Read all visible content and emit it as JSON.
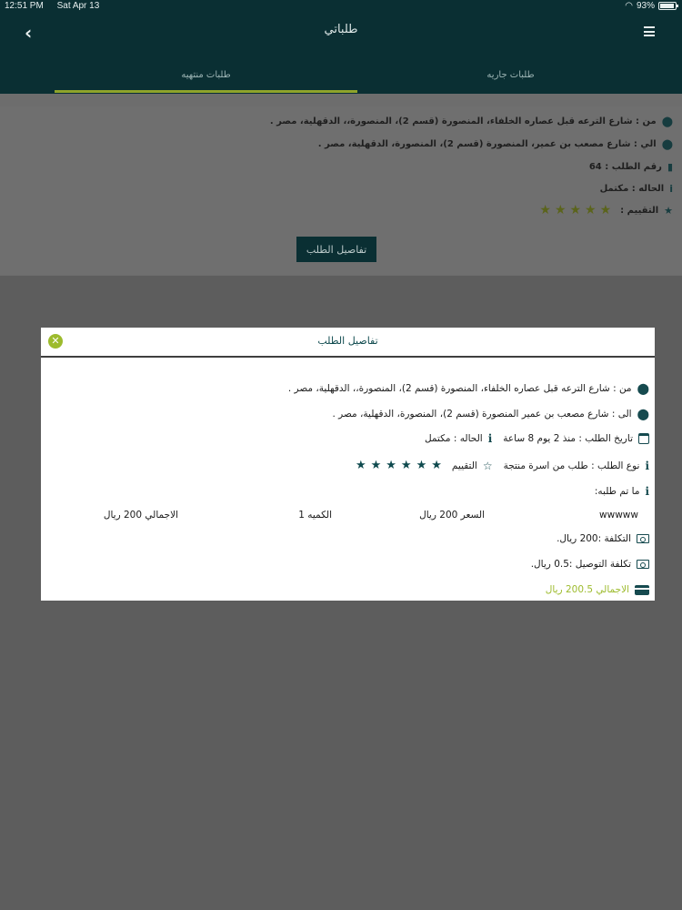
{
  "status": {
    "time": "12:51 PM",
    "date": "Sat Apr 13",
    "battery": "93%"
  },
  "header": {
    "title": "طلباتي"
  },
  "tabs": {
    "running": "طلبات جاريه",
    "finished": "طلبات منتهيه"
  },
  "order": {
    "from": "من : شارع الترعه قبل عصاره الخلفاء، المنصورة (قسم 2)، المنصورة،، الدقهلية، مصر .",
    "to": "الي : شارع مصعب بن عمير، المنصورة (قسم 2)، المنصورة، الدقهلية، مصر .",
    "number": "رقم الطلب : 64",
    "status": "الحاله : مكتمل",
    "rating_label": "التقييم :",
    "rating": 5,
    "details_button": "تفاصيل الطلب"
  },
  "modal": {
    "title": "تفاصيل الطلب",
    "from": "من : شارع الترعه قبل عصاره الخلفاء، المنصورة (قسم 2)، المنصورة،، الدقهلية، مصر .",
    "to": "الى : شارع مصعب بن عمير المنصورة (قسم 2)، المنصورة، الدقهلية، مصر .",
    "date": "تاريخ الطلب : منذ 2 يوم 8 ساعة",
    "status": "الحاله : مكتمل",
    "type": "نوع الطلب : طلب من اسرة منتجة",
    "rating_label": "التقييم",
    "rating": 5,
    "ordered_label": "ما تم طلبه:",
    "item": {
      "name": "wwwww",
      "price": "السعر  200 ريال",
      "quantity": "الكميه  1",
      "total": "الاجمالي  200 ريال"
    },
    "cost": "التكلفة :200 ريال.",
    "delivery": "تكلفة التوصيل :0.5 ريال.",
    "grand_total": "الاجمالي 200.5 ريال"
  },
  "colors": {
    "header": "#0a2f33",
    "accent": "#9dbb2d",
    "teal": "#164a4f"
  }
}
